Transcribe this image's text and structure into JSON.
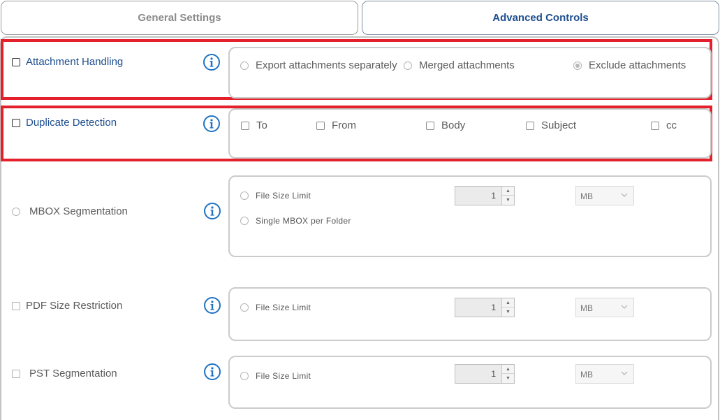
{
  "tabs": {
    "general": "General Settings",
    "advanced": "Advanced Controls"
  },
  "attachment": {
    "label": "Attachment Handling",
    "options": [
      "Export attachments separately",
      "Merged attachments",
      "Exclude attachments"
    ],
    "selected": "Exclude attachments"
  },
  "duplicate": {
    "label": "Duplicate Detection",
    "fields": [
      "To",
      "From",
      "Body",
      "Subject",
      "cc"
    ]
  },
  "mbox": {
    "label": "MBOX Segmentation",
    "option1": "File Size Limit",
    "option2": "Single MBOX per Folder",
    "value": "1",
    "unit": "MB"
  },
  "pdf": {
    "label": "PDF Size Restriction",
    "option": "File Size Limit",
    "value": "1",
    "unit": "MB"
  },
  "pst": {
    "label": "PST Segmentation",
    "option": "File Size Limit",
    "value": "1",
    "unit": "MB"
  },
  "colors": {
    "accent_blue": "#1d4e8f",
    "info_blue": "#1f72c2",
    "highlight_red": "#e3202b"
  },
  "icons": {
    "info": "info-icon",
    "spin_up": "chevron-up-icon",
    "spin_down": "chevron-down-icon",
    "dropdown": "chevron-down-icon"
  }
}
